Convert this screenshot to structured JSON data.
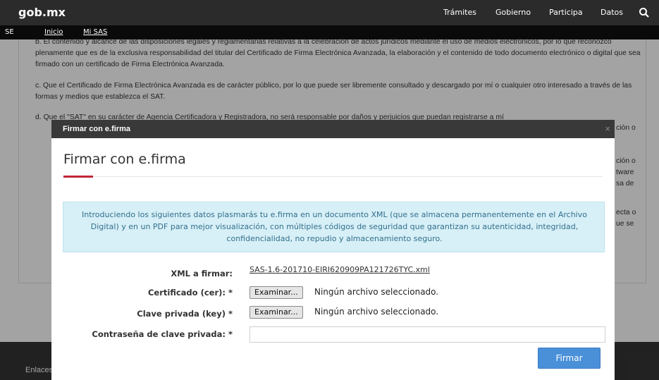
{
  "header": {
    "logo": "gob.mx",
    "nav": [
      "Trámites",
      "Gobierno",
      "Participa",
      "Datos"
    ],
    "search_icon": "search-icon"
  },
  "subnav": {
    "brand": "SE",
    "links": [
      "Inicio",
      "Mi SAS"
    ]
  },
  "background": {
    "paragraphs": [
      "b. El contenido y alcance de las disposiciones legales y reglamentarias relativas a la celebración de actos jurídicos mediante el uso de medios electrónicos, por lo que reconozco plenamente que es de la exclusiva responsabilidad del titular del Certificado de Firma Electrónica Avanzada, la elaboración y el contenido de todo documento electrónico o digital que sea firmado con un certificado de Firma Electrónica Avanzada.",
      "c. Que el Certificado de Firma Electrónica Avanzada es de carácter público, por lo que puede ser libremente consultado y descargado por mí o cualquier otro interesado a través de las formas y medios que establezca el SAT.",
      "d. Que el \"SAT\" en su carácter de Agencia Certificadora y Registradora, no será responsable por daños y perjuicios que puedan registrarse a mí"
    ],
    "right_fragments": [
      "ción o",
      "ción o",
      "tware",
      "sa de",
      "ecta o",
      "ue se"
    ]
  },
  "footer": {
    "links_label": "Enlaces"
  },
  "modal": {
    "header_title": "Firmar con e.firma",
    "close": "×",
    "title": "Firmar con e.firma",
    "info": "Introduciendo los siguientes datos plasmarás tu e.firma en un documento XML (que se almacena permanentemente en el Archivo Digital) y en un PDF para mejor visualización, con múltiples códigos de seguridad que garantizan su autenticidad, integridad, confidencialidad, no repudio y almacenamiento seguro.",
    "fields": {
      "xml_label": "XML a firmar:",
      "xml_value": "SAS-1.6-201710-EIRI620909PA121726TYC.xml",
      "cert_label": "Certificado (cer): *",
      "key_label": "Clave privada (key) *",
      "pwd_label": "Contraseña de clave privada: *",
      "browse": "Examinar...",
      "no_file": "Ningún archivo seleccionado.",
      "pwd_value": ""
    },
    "submit": "Firmar"
  },
  "colors": {
    "topbar": "#2b2b2b",
    "accent_red": "#c0273a",
    "info_bg": "#d7eff6",
    "primary": "#4a90d9"
  }
}
